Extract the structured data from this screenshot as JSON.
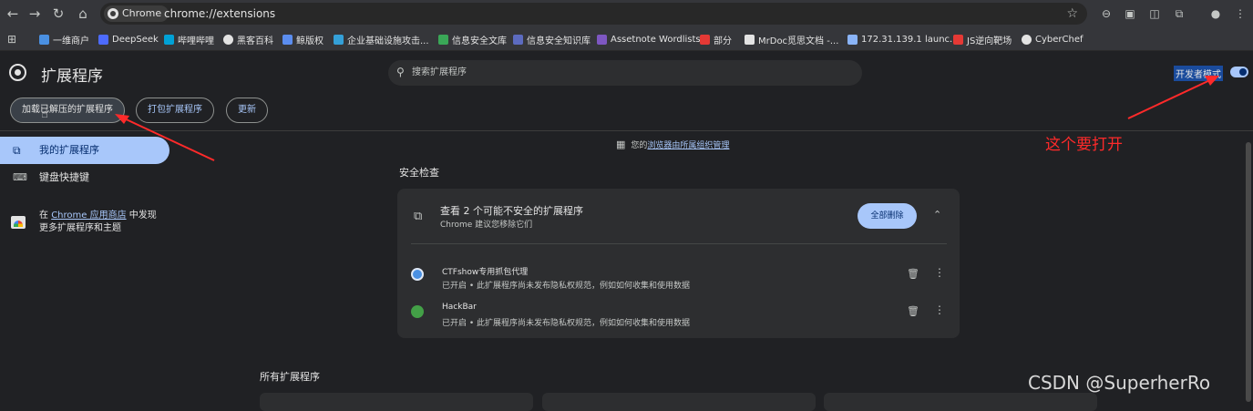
{
  "browser": {
    "chip_label": "Chrome",
    "url": "chrome://extensions"
  },
  "bookmarks": [
    {
      "label": "一维商户",
      "color": "#4a90e2"
    },
    {
      "label": "DeepSeek",
      "color": "#4d6bfe"
    },
    {
      "label": "哔哩哔哩",
      "color": "#00a1d6"
    },
    {
      "label": "黑客百科",
      "color": "#e3e3e3"
    },
    {
      "label": "鲸版权",
      "color": "#5b8def"
    },
    {
      "label": "企业基础设施攻击...",
      "color": "#34a0d8"
    },
    {
      "label": "信息安全文库",
      "color": "#3aa757"
    },
    {
      "label": "信息安全知识库",
      "color": "#5c6bc0"
    },
    {
      "label": "Assetnote Wordlists",
      "color": "#7e57c2"
    },
    {
      "label": "部分",
      "color": "#e53935"
    },
    {
      "label": "MrDoc觅思文档 -...",
      "color": "#e3e3e3"
    },
    {
      "label": "172.31.139.1 launc...",
      "color": "#8ab4f8"
    },
    {
      "label": "JS逆向靶场",
      "color": "#e53935"
    },
    {
      "label": "CyberChef",
      "color": "#e3e3e3"
    }
  ],
  "header": {
    "title": "扩展程序",
    "search_placeholder": "搜索扩展程序",
    "dev_mode_label": "开发者模式",
    "dev_mode_on": true
  },
  "toolbar": {
    "load_unpacked": "加载已解压的扩展程序",
    "pack": "打包扩展程序",
    "update": "更新"
  },
  "sidebar": {
    "my_extensions": "我的扩展程序",
    "keyboard_shortcuts": "键盘快捷键",
    "store_prefix": "在 ",
    "store_link": "Chrome 应用商店",
    "store_suffix": " 中发现",
    "store_line2": "更多扩展程序和主题"
  },
  "main": {
    "managed_prefix": "您的",
    "managed_link": "浏览器由所属组织管理",
    "safety_heading": "安全检查",
    "card_title": "查看 2 个可能不安全的扩展程序",
    "card_subtitle": "Chrome 建议您移除它们",
    "remove_all": "全部删除",
    "extensions": [
      {
        "name": "CTFshow专用抓包代理",
        "desc": "已开启 • 此扩展程序尚未发布隐私权规范，例如如何收集和使用数据",
        "color": "#4a90e2"
      },
      {
        "name": "HackBar",
        "desc": "已开启 • 此扩展程序尚未发布隐私权规范，例如如何收集和使用数据",
        "color": "#43a047"
      }
    ],
    "all_heading": "所有扩展程序"
  },
  "overlay": {
    "annotation": "这个要打开",
    "annotation_color": "#ff2a2a",
    "watermark": "CSDN @SuperherRo"
  }
}
